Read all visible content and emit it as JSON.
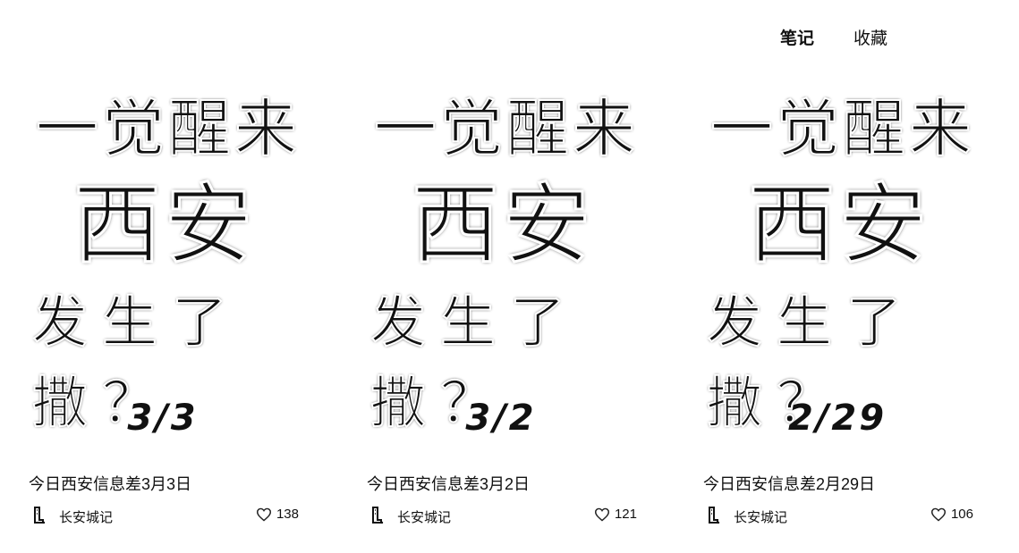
{
  "tabs": [
    {
      "label": "笔记",
      "active": true
    },
    {
      "label": "收藏",
      "active": false
    }
  ],
  "cards": [
    {
      "cover": {
        "line1": "一觉醒来",
        "line2": "西安",
        "line3": "发生了撒？",
        "date": "3/3"
      },
      "title": "今日西安信息差3月3日",
      "author": "长安城记",
      "likes": "138"
    },
    {
      "cover": {
        "line1": "一觉醒来",
        "line2": "西安",
        "line3": "发生了撒？",
        "date": "3/2"
      },
      "title": "今日西安信息差3月2日",
      "author": "长安城记",
      "likes": "121"
    },
    {
      "cover": {
        "line1": "一觉醒来",
        "line2": "西安",
        "line3": "发生了撒？",
        "date": "2/29"
      },
      "title": "今日西安信息差2月29日",
      "author": "长安城记",
      "likes": "106"
    }
  ],
  "icons": {
    "avatar": "avatar-icon",
    "like": "heart-icon"
  }
}
